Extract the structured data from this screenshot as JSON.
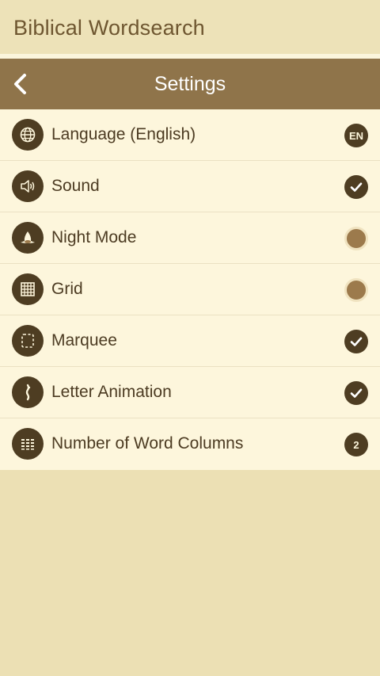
{
  "app": {
    "title": "Biblical Wordsearch"
  },
  "header": {
    "title": "Settings"
  },
  "colors": {
    "brown_dark": "#4e3d22",
    "brown_header": "#8f744a",
    "toggle_off": "#9c7a4c",
    "background": "#ece0b4",
    "list_bg": "#fdf6dc"
  },
  "settings": [
    {
      "label": "Language (English)",
      "icon": "globe-icon",
      "badge": "EN"
    },
    {
      "label": "Sound",
      "icon": "speaker-icon",
      "state": "on"
    },
    {
      "label": "Night Mode",
      "icon": "night-mode-icon",
      "state": "off"
    },
    {
      "label": "Grid",
      "icon": "grid-icon",
      "state": "off"
    },
    {
      "label": "Marquee",
      "icon": "marquee-icon",
      "state": "on"
    },
    {
      "label": "Letter Animation",
      "icon": "letter-animation-icon",
      "state": "on"
    },
    {
      "label": "Number of Word Columns",
      "icon": "columns-icon",
      "badge": "2"
    }
  ]
}
